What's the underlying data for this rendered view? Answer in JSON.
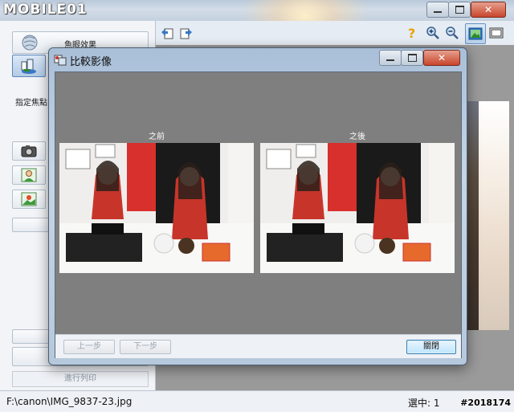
{
  "watermark": {
    "logo_text": "MOBILE01"
  },
  "window": {
    "controls": {
      "minimize": "—",
      "maximize": "□",
      "close": "✕"
    }
  },
  "left_panel": {
    "fisheye_label": "魚眼效果",
    "focus_label": "指定焦點",
    "print_label": "進行列印"
  },
  "dialog": {
    "title": "比較影像",
    "before_label": "之前",
    "after_label": "之後",
    "prev_button": "上一步",
    "next_button": "下一步",
    "close_button": "關閉"
  },
  "statusbar": {
    "path": "F:\\canon\\IMG_9837-23.jpg",
    "selection": "選中: 1"
  },
  "post_id": "#2018174",
  "colors": {
    "accent": "#3c7fb1",
    "red_close": "#c9452c",
    "canvas_gray": "#7f7f7f"
  }
}
